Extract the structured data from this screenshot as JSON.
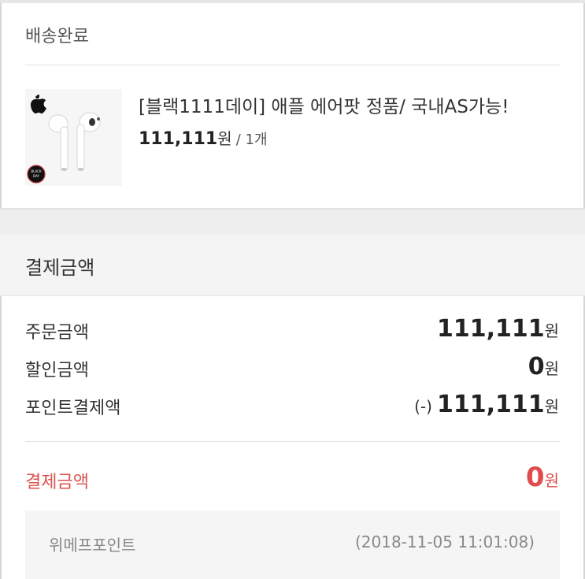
{
  "delivery": {
    "status_title": "배송완료",
    "product": {
      "name": "[블랙1111데이] 애플 에어팟 정품/ 국내AS가능!",
      "price": "111,111",
      "price_unit": "원",
      "quantity": "/ 1개",
      "thumbnail_badge_text": "BLACK DAY"
    }
  },
  "payment": {
    "section_title": "결제금액",
    "rows": [
      {
        "label": "주문금액",
        "prefix": "",
        "amount": "111,111",
        "unit": "원"
      },
      {
        "label": "할인금액",
        "prefix": "",
        "amount": "0",
        "unit": "원"
      },
      {
        "label": "포인트결제액",
        "prefix": "(-)",
        "amount": "111,111",
        "unit": "원"
      }
    ],
    "total": {
      "label": "결제금액",
      "amount": "0",
      "unit": "원"
    },
    "points": {
      "label": "위메프포인트",
      "date": "(2018-11-05 11:01:08)"
    }
  },
  "colors": {
    "accent_red": "#e04b4b",
    "label_red": "#d9534f",
    "header_bg": "#f4f4f4"
  }
}
